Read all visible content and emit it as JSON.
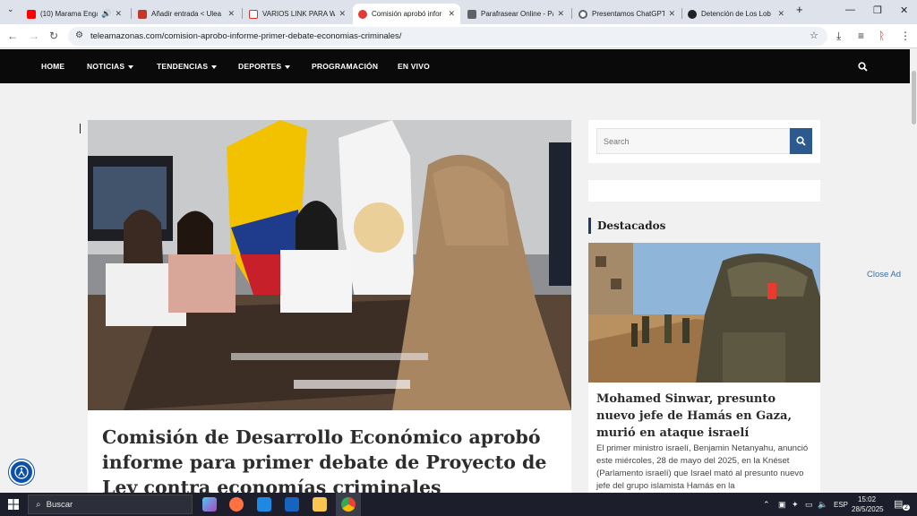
{
  "browser": {
    "tabs": [
      {
        "label": "(10) Marama Enga",
        "icon": "youtube-icon",
        "color": "#ff0000"
      },
      {
        "label": "Añadir entrada < Ulea",
        "icon": "ulea-icon",
        "color": "#c0392b"
      },
      {
        "label": "VARIOS LINK PARA W",
        "icon": "gmail-icon",
        "color": "#d93025"
      },
      {
        "label": "Comisión aprobó infor",
        "icon": "teleamazonas-icon",
        "color": "#e53935",
        "active": true
      },
      {
        "label": "Parafrasear Online - Pa",
        "icon": "document-icon",
        "color": "#5f6368"
      },
      {
        "label": "Presentamos ChatGPT",
        "icon": "chatgpt-icon",
        "color": "#5f6368"
      },
      {
        "label": "Detención de Los Lob",
        "icon": "chatgpt-icon",
        "color": "#202124"
      }
    ],
    "url": "teleamazonas.com/comision-aprobo-informe-primer-debate-economias-criminales/"
  },
  "site": {
    "nav": [
      "HOME",
      "NOTICIAS",
      "TENDENCIAS",
      "DEPORTES",
      "PROGRAMACIÓN",
      "EN VIVO"
    ]
  },
  "article": {
    "headline": "Comisión de Desarrollo Económico aprobó informe para primer debate de Proyecto de Ley contra economías criminales"
  },
  "sidebar": {
    "search_placeholder": "Search",
    "section_title": "Destacados",
    "featured_title": "Mohamed Sinwar, presunto nuevo jefe de Hamás en Gaza, murió en ataque israelí",
    "featured_excerpt": "El primer ministro israelí, Benjamin Netanyahu, anunció este miércoles, 28 de mayo del 2025, en la Knéset (Parlamento israelí) que Israel mató al presunto nuevo jefe del grupo islamista Hamás en la"
  },
  "close_ad": "Close Ad",
  "taskbar": {
    "search": "Buscar",
    "lang": "ESP",
    "time": "15:02",
    "date": "28/5/2025",
    "notifications": "2"
  }
}
